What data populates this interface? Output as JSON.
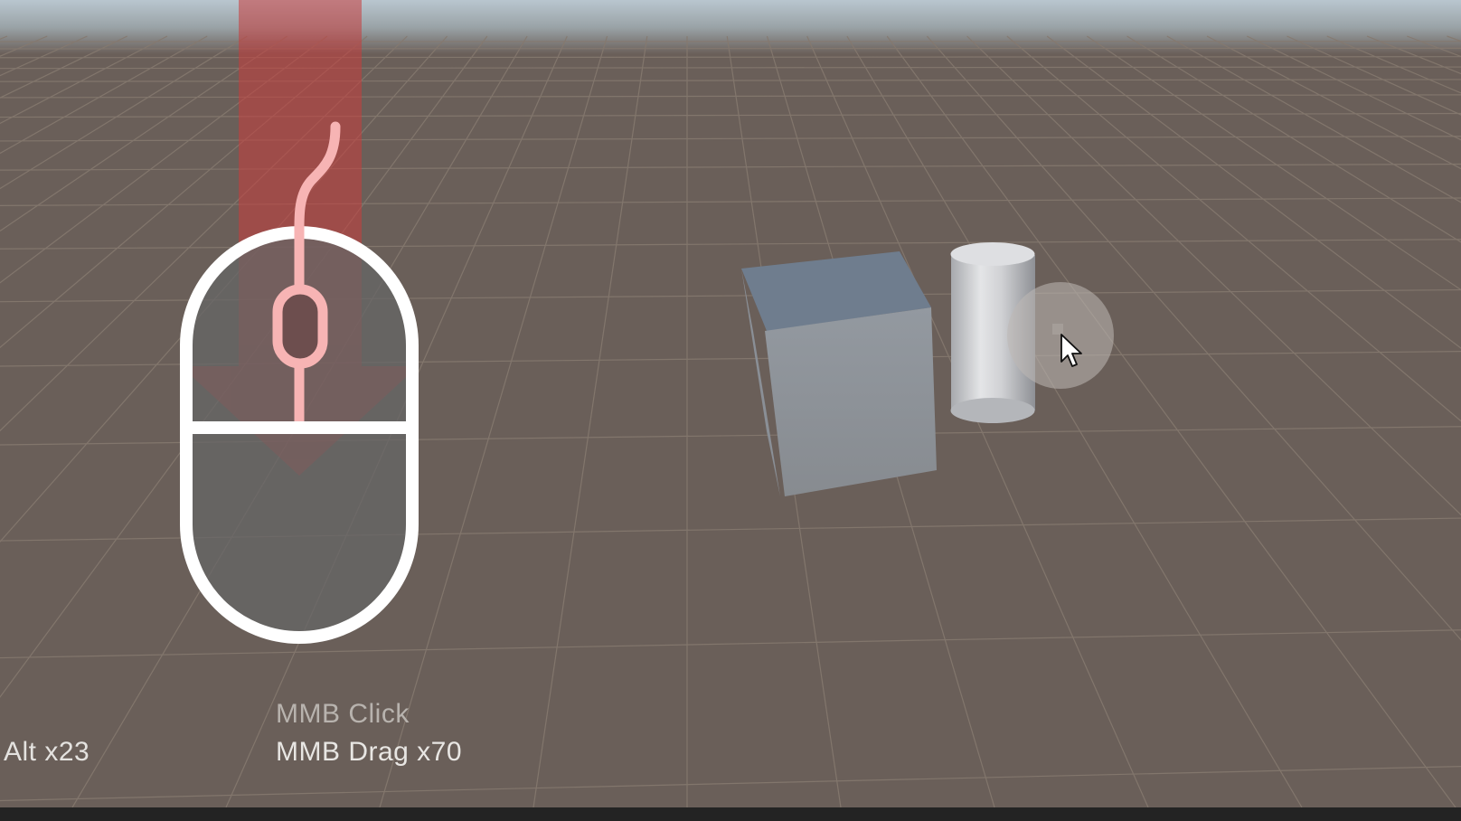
{
  "scene": {
    "colors": {
      "ground": "#6a5f59",
      "sky": "#aebcc7",
      "grid_line": "#8a807a",
      "cube_top": "#6f7d8e",
      "cube_front": "#8e939a",
      "cylinder": "#c8c9cc",
      "bottom_bar": "#232323"
    },
    "objects": [
      "cube",
      "cylinder"
    ]
  },
  "input_overlay": {
    "mouse_icon": "mouse-icon",
    "arrow_icon": "arrow-down-icon",
    "cursor_icon": "arrow-cursor-icon",
    "highlight_color": "#c83c3c",
    "mouse_outline_color": "#ffffff",
    "mouse_fill_color": "#666666",
    "wheel_color": "#f7b4b4"
  },
  "hud": {
    "modifier": "Alt x23",
    "mmb_click": "MMB Click",
    "mmb_drag": "MMB Drag x70"
  }
}
